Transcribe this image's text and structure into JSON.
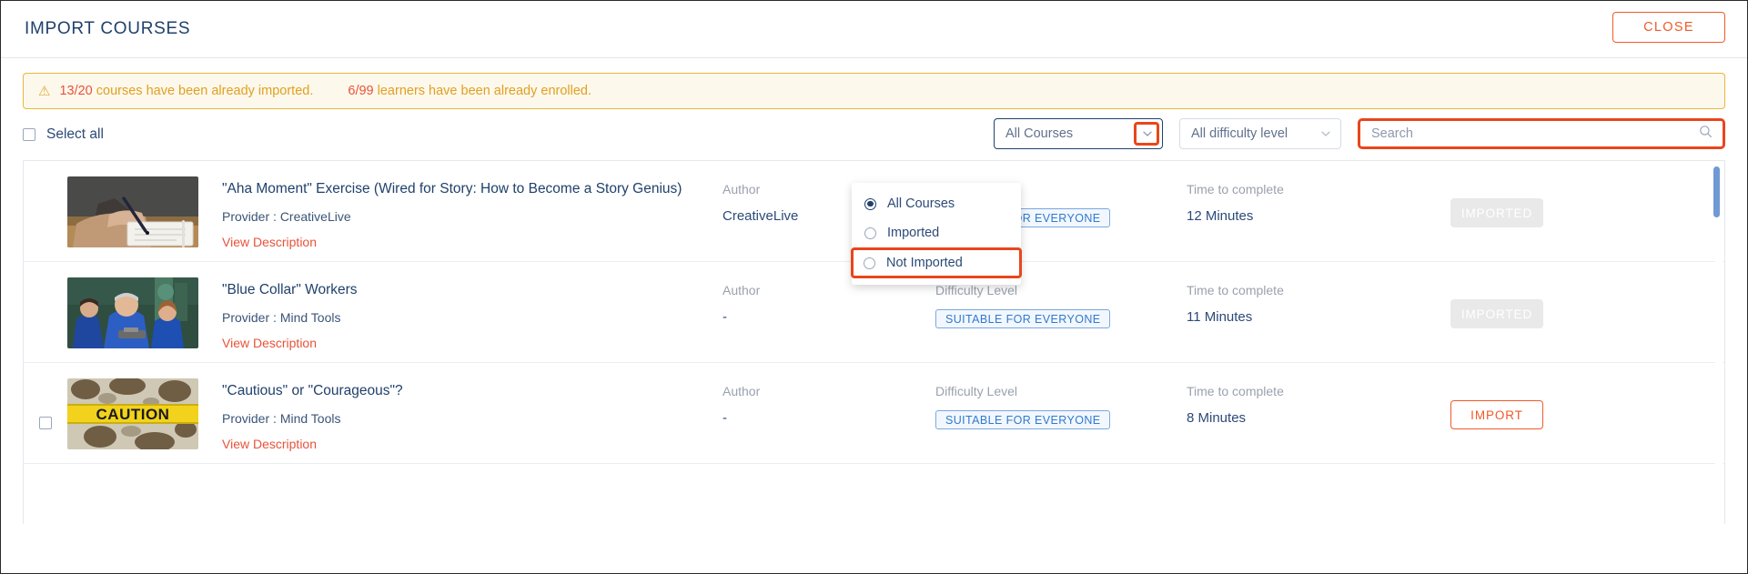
{
  "header": {
    "title": "IMPORT COURSES",
    "close_label": "CLOSE"
  },
  "alert": {
    "icon": "warning-triangle-icon",
    "courses_count": "13/20",
    "courses_text": " courses have been already imported.",
    "learners_count": "6/99",
    "learners_text": " learners have been already enrolled."
  },
  "toolbar": {
    "select_all_label": "Select all",
    "course_filter": {
      "selected": "All Courses",
      "options": [
        "All Courses",
        "Imported",
        "Not Imported"
      ],
      "checked_index": 0,
      "highlighted_index": 2
    },
    "difficulty_filter": {
      "selected": "All difficulty level"
    },
    "search": {
      "value": "",
      "placeholder": "Search"
    }
  },
  "columns": {
    "author": "Author",
    "difficulty": "Difficulty Level",
    "time": "Time to complete"
  },
  "provider_label": "Provider",
  "provider_sep": ":",
  "view_description_label": "View Description",
  "courses": [
    {
      "title": "\"Aha Moment\" Exercise (Wired for Story: How to Become a Story Genius)",
      "provider": "CreativeLive",
      "author": "CreativeLive",
      "difficulty": "SUITABLE FOR EVERYONE",
      "time": "12 Minutes",
      "action_label": "IMPORTED",
      "action_state": "imported",
      "thumb": "writing-hand-notebook",
      "checkbox_visible": false
    },
    {
      "title": "\"Blue Collar\" Workers",
      "provider": "Mind Tools",
      "author": "-",
      "difficulty": "SUITABLE FOR EVERYONE",
      "time": "11 Minutes",
      "action_label": "IMPORTED",
      "action_state": "imported",
      "thumb": "workers-factory",
      "checkbox_visible": false
    },
    {
      "title": "\"Cautious\" or \"Courageous\"?",
      "provider": "Mind Tools",
      "author": "-",
      "difficulty": "SUITABLE FOR EVERYONE",
      "time": "8 Minutes",
      "action_label": "IMPORT",
      "action_state": "import",
      "thumb": "caution-tape",
      "checkbox_visible": true
    }
  ],
  "colors": {
    "accent_orange": "#f05a28",
    "highlight_red": "#e8461b",
    "navy": "#20416b",
    "alert_amber": "#e0a020",
    "badge_blue": "#2f7ad0",
    "scrollbar_blue": "#6f9ad4"
  }
}
